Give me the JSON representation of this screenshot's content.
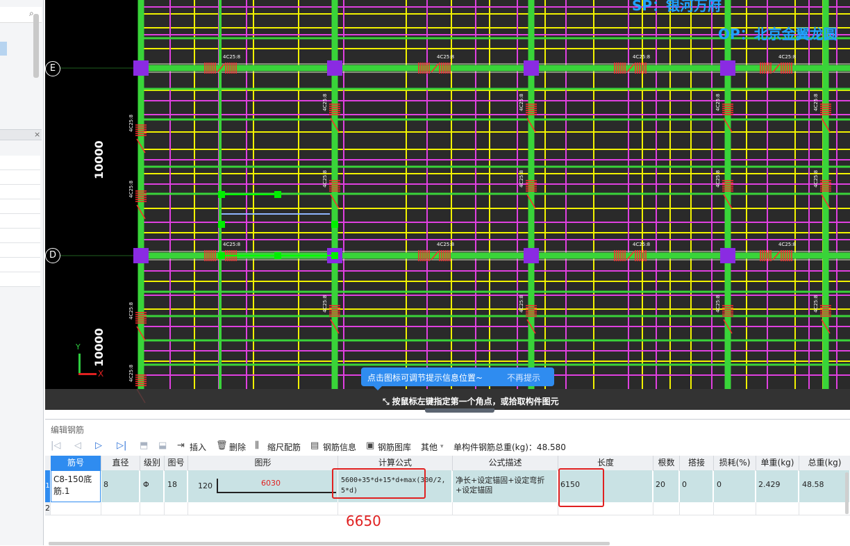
{
  "cad": {
    "overlay_sp": "SP：银河万府",
    "overlay_op": "OP：北京金翼龙圆",
    "axis_labels": [
      "E",
      "D"
    ],
    "dimension_labels": [
      "10000",
      "10000"
    ],
    "rebar_tag": "4C25:8",
    "tip": {
      "message": "点击图标可调节提示信息位置~",
      "dismiss": "不再提示"
    },
    "hint": "按鼠标左键指定第一个角点，或拾取构件图元",
    "colors": {
      "background": "#000000",
      "beam_green": "#39d439",
      "rebar_yellow": "#f2f200",
      "rebar_magenta": "#e040e0",
      "column_purple": "#8a2be2",
      "rebar_red": "#ff2a2a",
      "tip_blue": "#2f8cf0"
    },
    "coord_axis": {
      "x": "X",
      "y": "Y"
    }
  },
  "panel": {
    "title": "编辑钢筋",
    "toolbar": {
      "insert": "插入",
      "delete": "删除",
      "scale_rebar": "缩尺配筋",
      "rebar_info": "钢筋信息",
      "rebar_library": "钢筋图库",
      "other": "其他",
      "total_weight": "单构件钢筋总重(kg)：48.580"
    },
    "table": {
      "headers": [
        "筋号",
        "直径(mm)",
        "级别",
        "图号",
        "图形",
        "计算公式",
        "公式描述",
        "长度",
        "根数",
        "搭接",
        "损耗(%)",
        "单重(kg)",
        "总重(kg)"
      ],
      "row1": {
        "index": "1",
        "name": "C8-150底筋.1",
        "diameter": "8",
        "grade": "Φ",
        "figure_no": "18",
        "shape_left": "120",
        "shape_value": "6030",
        "formula": "5600+35*d+15*d+max(300/2,5*d)",
        "description": "净长+设定锚固+设定弯折+设定锚固",
        "length": "6150",
        "count": "20",
        "lap": "0",
        "loss": "0",
        "unit_weight": "2.429",
        "total_weight": "48.58"
      },
      "row2_index": "2"
    },
    "annotation": "6650"
  }
}
